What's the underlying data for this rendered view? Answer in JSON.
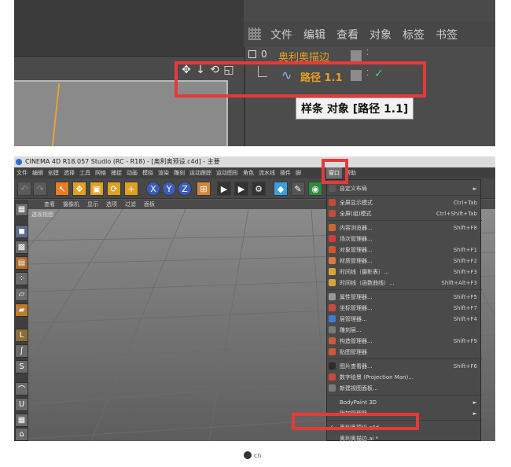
{
  "top_panel": {
    "object_manager_menu": [
      "文件",
      "编辑",
      "查看",
      "对象",
      "标签",
      "书签"
    ],
    "row1_name": "奥利奥描边",
    "row2_name": "路径 1.1",
    "tooltip": "样条 对象 [路径 1.1]"
  },
  "app": {
    "title": "CINEMA 4D R18.057 Studio (RC - R18) - [奥利奥预设.c4d] - 主要",
    "menu": [
      "文件",
      "编辑",
      "创建",
      "选择",
      "工具",
      "网格",
      "捕捉",
      "动画",
      "模拟",
      "渲染",
      "雕刻",
      "运动跟踪",
      "运动图形",
      "角色",
      "流水线",
      "插件",
      "脚"
    ],
    "window_menu_label": "窗口",
    "help_label": "帮助",
    "view_menu": [
      "查看",
      "摄像机",
      "显示",
      "选项",
      "过滤",
      "面板"
    ],
    "viewport_label": "透视视图",
    "window_menu_items": [
      {
        "label": "自定义布局",
        "shortcut": "",
        "arrow": "►"
      },
      {
        "label": "全屏显示模式",
        "shortcut": "Ctrl+Tab"
      },
      {
        "label": "全屏(组)模式",
        "shortcut": "Ctrl+Shift+Tab"
      },
      {
        "label": "内容浏览器...",
        "shortcut": "Shift+F8"
      },
      {
        "label": "场次管理器...",
        "shortcut": ""
      },
      {
        "label": "对象管理器...",
        "shortcut": "Shift+F1"
      },
      {
        "label": "材质管理器...",
        "shortcut": "Shift+F2"
      },
      {
        "label": "时间线（摄影表）...",
        "shortcut": "Shift+F3"
      },
      {
        "label": "时间线（函数曲线）...",
        "shortcut": "Shift+Alt+F3"
      },
      {
        "label": "属性管理器...",
        "shortcut": "Shift+F5"
      },
      {
        "label": "坐标管理器...",
        "shortcut": "Shift+F7"
      },
      {
        "label": "层管理器...",
        "shortcut": "Shift+F4"
      },
      {
        "label": "雕刻层...",
        "shortcut": ""
      },
      {
        "label": "构造管理器...",
        "shortcut": "Shift+F9"
      },
      {
        "label": "贴图管理器",
        "shortcut": ""
      },
      {
        "label": "图片查看器...",
        "shortcut": "Shift+F6"
      },
      {
        "label": "数字绘景 (Projection Man)...",
        "shortcut": ""
      },
      {
        "label": "新建视图面板...",
        "shortcut": ""
      },
      {
        "label": "BodyPaint 3D",
        "shortcut": "",
        "arrow": "►"
      },
      {
        "label": "附加管理器",
        "shortcut": "",
        "arrow": "►"
      },
      {
        "label": "奥利奥预设.c4d",
        "shortcut": "",
        "check": "✓"
      },
      {
        "label": "奥利奥描边.ai *",
        "shortcut": ""
      }
    ]
  },
  "logo_text": "cn",
  "colors": {
    "highlight_red": "#e53a3a",
    "accent_orange": "#e8a020"
  }
}
